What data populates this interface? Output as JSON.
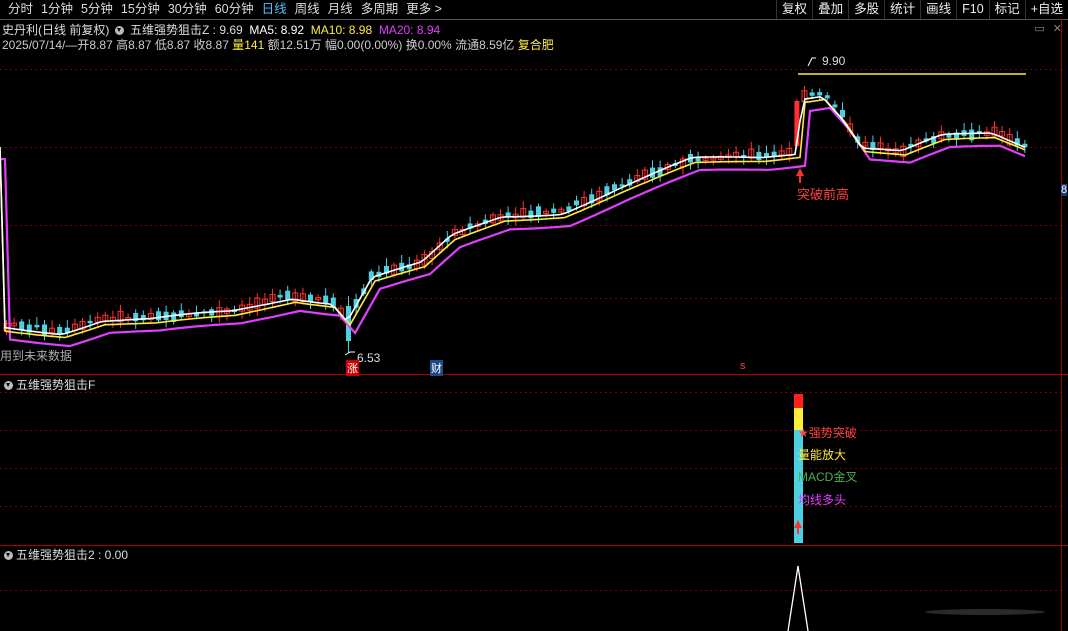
{
  "periods": [
    "分时",
    "1分钟",
    "5分钟",
    "15分钟",
    "30分钟",
    "60分钟",
    "日线",
    "周线",
    "月线",
    "多周期",
    "更多 >"
  ],
  "active_period": "日线",
  "tools": [
    "复权",
    "叠加",
    "多股",
    "统计",
    "画线",
    "F10",
    "标记",
    "+自选"
  ],
  "header": {
    "stock_name": "史丹利(日线 前复权)",
    "indicator": "五维强势狙击Z : 9.69",
    "ma5": "MA5: 8.92",
    "ma10": "MA10: 8.98",
    "ma20": "MA20: 8.94",
    "date": "2025/07/14/—",
    "open": "开8.87",
    "high": "高8.87",
    "low": "低8.87",
    "close": "收8.87",
    "volume": "量141",
    "amount": "额12.51万",
    "change": "幅0.00(0.00%)",
    "turnover": "换0.00%",
    "float": "流通8.59亿",
    "sector": "复合肥"
  },
  "labels": {
    "high_price": "9.90",
    "low_price": "6.53",
    "breakthrough": "突破前高",
    "future_data": "用到未来数据",
    "marker_zhang": "涨",
    "marker_cai": "财",
    "marker_s": "s",
    "right_edge": "8"
  },
  "panel2": {
    "title": "五维强势狙击F",
    "signal_strong": "强势突破",
    "signal_volume": "量能放大",
    "signal_macd": "MACD金叉",
    "signal_ma": "均线多头"
  },
  "panel3": {
    "title": "五维强势狙击2 : 0.00"
  },
  "colors": {
    "up": "#ff3030",
    "down": "#4dd0e1",
    "ma5": "#ffffff",
    "ma10": "#ffeb3b",
    "ma20": "#e040fb",
    "grid": "#7a0000"
  }
}
